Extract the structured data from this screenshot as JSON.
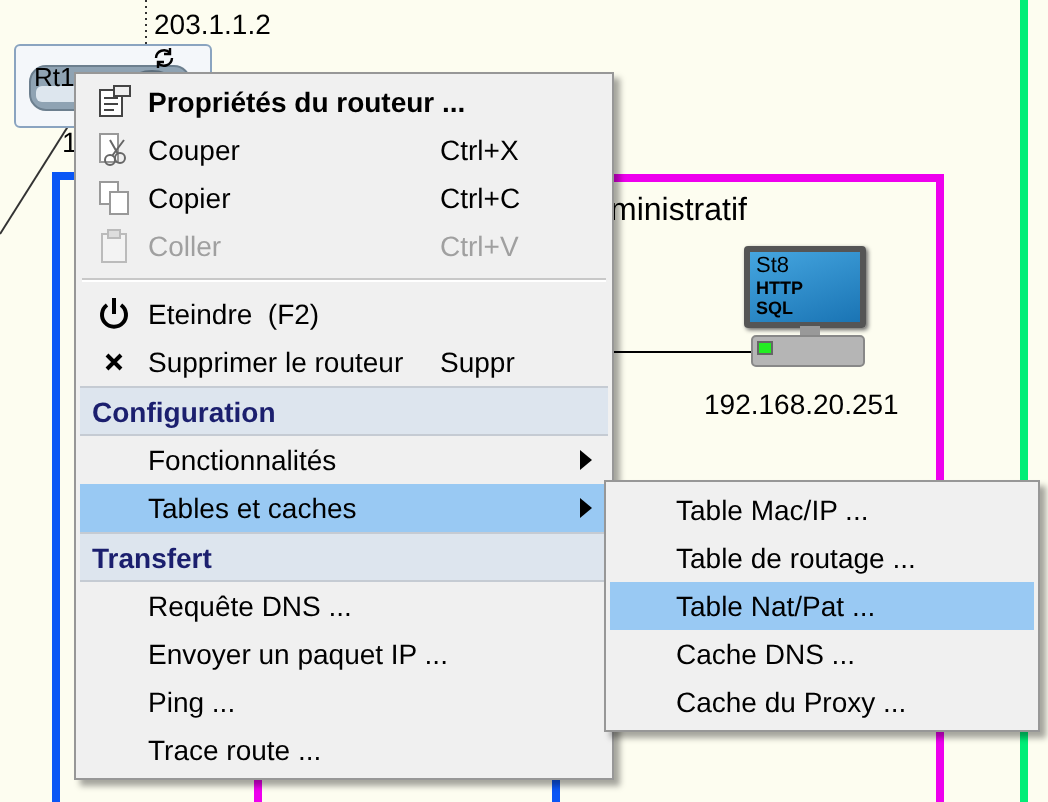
{
  "canvas": {
    "wan_address": "203.1.1.2",
    "router": {
      "name": "Rt1",
      "address": "1"
    },
    "network": {
      "name": "ministratif"
    },
    "station": {
      "name": "St8",
      "services": [
        "HTTP",
        "SQL"
      ],
      "address": "192.168.20.251"
    }
  },
  "context_menu": {
    "items": [
      {
        "kind": "item",
        "label": "Propriétés du routeur ...",
        "default": true,
        "disabled": false,
        "selected": false,
        "submenu": false
      },
      {
        "kind": "item",
        "label": "Couper",
        "shortcut": "Ctrl+X",
        "default": false,
        "disabled": false,
        "selected": false,
        "submenu": false
      },
      {
        "kind": "item",
        "label": "Copier",
        "shortcut": "Ctrl+C",
        "default": false,
        "disabled": false,
        "selected": false,
        "submenu": false
      },
      {
        "kind": "item",
        "label": "Coller",
        "shortcut": "Ctrl+V",
        "default": false,
        "disabled": true,
        "selected": false,
        "submenu": false
      },
      {
        "kind": "separator"
      },
      {
        "kind": "item",
        "label": "Eteindre  (F2)",
        "default": false,
        "disabled": false,
        "selected": false,
        "submenu": false
      },
      {
        "kind": "item",
        "label": "Supprimer le routeur",
        "shortcut": "Suppr",
        "default": false,
        "disabled": false,
        "selected": false,
        "submenu": false
      },
      {
        "kind": "header",
        "label": "Configuration"
      },
      {
        "kind": "item",
        "label": "Fonctionnalités",
        "default": false,
        "disabled": false,
        "selected": false,
        "submenu": true
      },
      {
        "kind": "item",
        "label": "Tables et caches",
        "default": false,
        "disabled": false,
        "selected": true,
        "submenu": true
      },
      {
        "kind": "header",
        "label": "Transfert"
      },
      {
        "kind": "item",
        "label": "Requête DNS ...",
        "default": false,
        "disabled": false,
        "selected": false,
        "submenu": false
      },
      {
        "kind": "item",
        "label": "Envoyer un paquet IP ...",
        "default": false,
        "disabled": false,
        "selected": false,
        "submenu": false
      },
      {
        "kind": "item",
        "label": "Ping ...",
        "default": false,
        "disabled": false,
        "selected": false,
        "submenu": false
      },
      {
        "kind": "item",
        "label": "Trace route ...",
        "default": false,
        "disabled": false,
        "selected": false,
        "submenu": false
      }
    ]
  },
  "submenu": {
    "items": [
      {
        "label": "Table Mac/IP ...",
        "selected": false
      },
      {
        "label": "Table de routage ...",
        "selected": false
      },
      {
        "label": "Table Nat/Pat ...",
        "selected": true
      },
      {
        "label": "Cache DNS ...",
        "selected": false
      },
      {
        "label": "Cache du Proxy ...",
        "selected": false
      }
    ]
  }
}
